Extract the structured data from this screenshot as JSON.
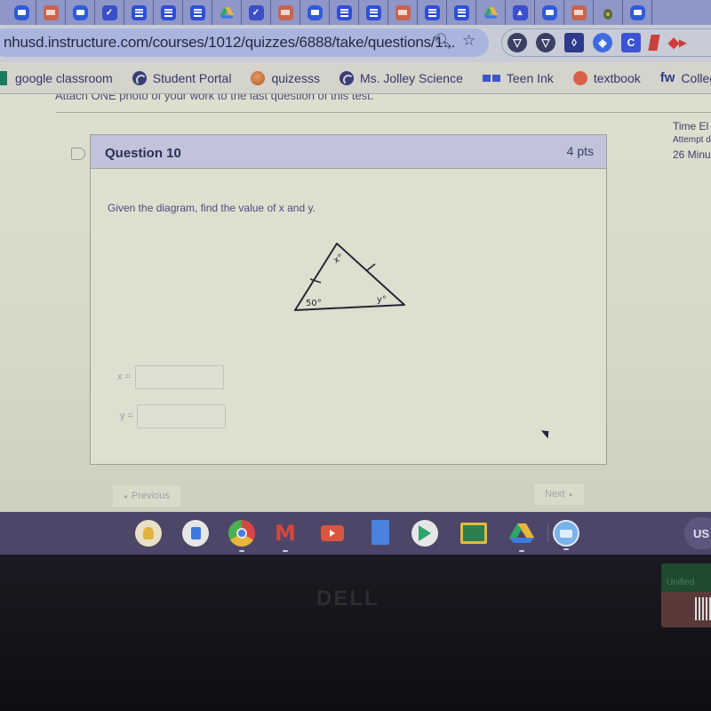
{
  "browser": {
    "tabs": [
      {
        "icon": "meet-icon",
        "kind": "meet"
      },
      {
        "icon": "slides-icon",
        "kind": "slides"
      },
      {
        "icon": "meet-icon",
        "kind": "meet"
      },
      {
        "icon": "forms-icon",
        "kind": "forms"
      },
      {
        "icon": "docs-icon",
        "kind": "docs"
      },
      {
        "icon": "docs-icon",
        "kind": "docs"
      },
      {
        "icon": "docs-icon",
        "kind": "docs"
      },
      {
        "icon": "drive-icon",
        "kind": "drive"
      },
      {
        "icon": "forms-icon",
        "kind": "forms"
      },
      {
        "icon": "slides-icon",
        "kind": "slides"
      },
      {
        "icon": "meet-icon",
        "kind": "meet"
      },
      {
        "icon": "docs-icon",
        "kind": "docs"
      },
      {
        "icon": "docs-icon",
        "kind": "docs"
      },
      {
        "icon": "slides-icon",
        "kind": "slides"
      },
      {
        "icon": "docs-icon",
        "kind": "docs"
      },
      {
        "icon": "docs-icon",
        "kind": "docs"
      },
      {
        "icon": "drive-icon",
        "kind": "drive"
      },
      {
        "icon": "classroom-icon",
        "kind": "classroom"
      },
      {
        "icon": "meet-icon",
        "kind": "meet"
      },
      {
        "icon": "slides-icon",
        "kind": "slides"
      },
      {
        "icon": "seed-icon",
        "kind": "seed"
      },
      {
        "icon": "meet-icon",
        "kind": "meet"
      }
    ],
    "url": "nhusd.instructure.com/courses/1012/quizzes/6888/take/questions/1...",
    "omnibox_icons": [
      "zoom-icon",
      "bookmark-star-icon"
    ],
    "extensions": [
      {
        "name": "shield-extension-icon",
        "glyph": "▽",
        "style": "circle"
      },
      {
        "name": "shield-extension-icon",
        "glyph": "▽",
        "style": "circle"
      },
      {
        "name": "diamond-extension-icon",
        "glyph": "◊",
        "style": "sq"
      },
      {
        "name": "blue-shield-extension-icon",
        "glyph": "◈",
        "style": "blue"
      },
      {
        "name": "c-extension-icon",
        "glyph": "C",
        "style": "cblue"
      },
      {
        "name": "red-extension-icon",
        "glyph": "",
        "style": "red"
      },
      {
        "name": "red-arrow-extension-icon",
        "glyph": "◆▸",
        "style": "redarrow"
      }
    ],
    "bookmarks": [
      {
        "label": "google classroom",
        "icon": "gc"
      },
      {
        "label": "Student Portal",
        "icon": "globe"
      },
      {
        "label": "quizesss",
        "icon": "quiz"
      },
      {
        "label": "Ms. Jolley Science",
        "icon": "globe"
      },
      {
        "label": "Teen Ink",
        "icon": "teen"
      },
      {
        "label": "textbook",
        "icon": "textbook"
      },
      {
        "label": "College Search - F",
        "icon": "fw",
        "icon_text": "fw"
      }
    ]
  },
  "quiz": {
    "instruction_partial": "Attach ONE photo of your work to the last question of this test.",
    "question": {
      "title": "Question 10",
      "points": "4 pts",
      "prompt": "Given the diagram, find the value of x and y.",
      "diagram": {
        "labels": {
          "top": "x°",
          "bottom_left": "50°",
          "bottom_right": "y°"
        },
        "note": "isosceles triangle with tick marks on the two upper sides"
      },
      "answers": [
        {
          "label": "x =",
          "value": "",
          "placeholder": ""
        },
        {
          "label": "y =",
          "value": "",
          "placeholder": ""
        }
      ]
    },
    "nav": {
      "previous": "Previous",
      "previous_glyph": "◂",
      "next": "Next",
      "next_glyph": "▸"
    },
    "side_panel": {
      "time_elapsed": "Time El",
      "attempt": "Attempt d",
      "minutes": "26 Minu"
    }
  },
  "shelf": {
    "apps": [
      "keep-icon",
      "docs-icon",
      "chrome-icon",
      "gmail-icon",
      "youtube-icon",
      "docs-file-icon",
      "play-store-icon",
      "classroom-icon",
      "drive-icon",
      "meet-icon"
    ],
    "status_text": "US"
  },
  "hardware": {
    "brand": "DELL",
    "sticker_text": "Unified"
  }
}
